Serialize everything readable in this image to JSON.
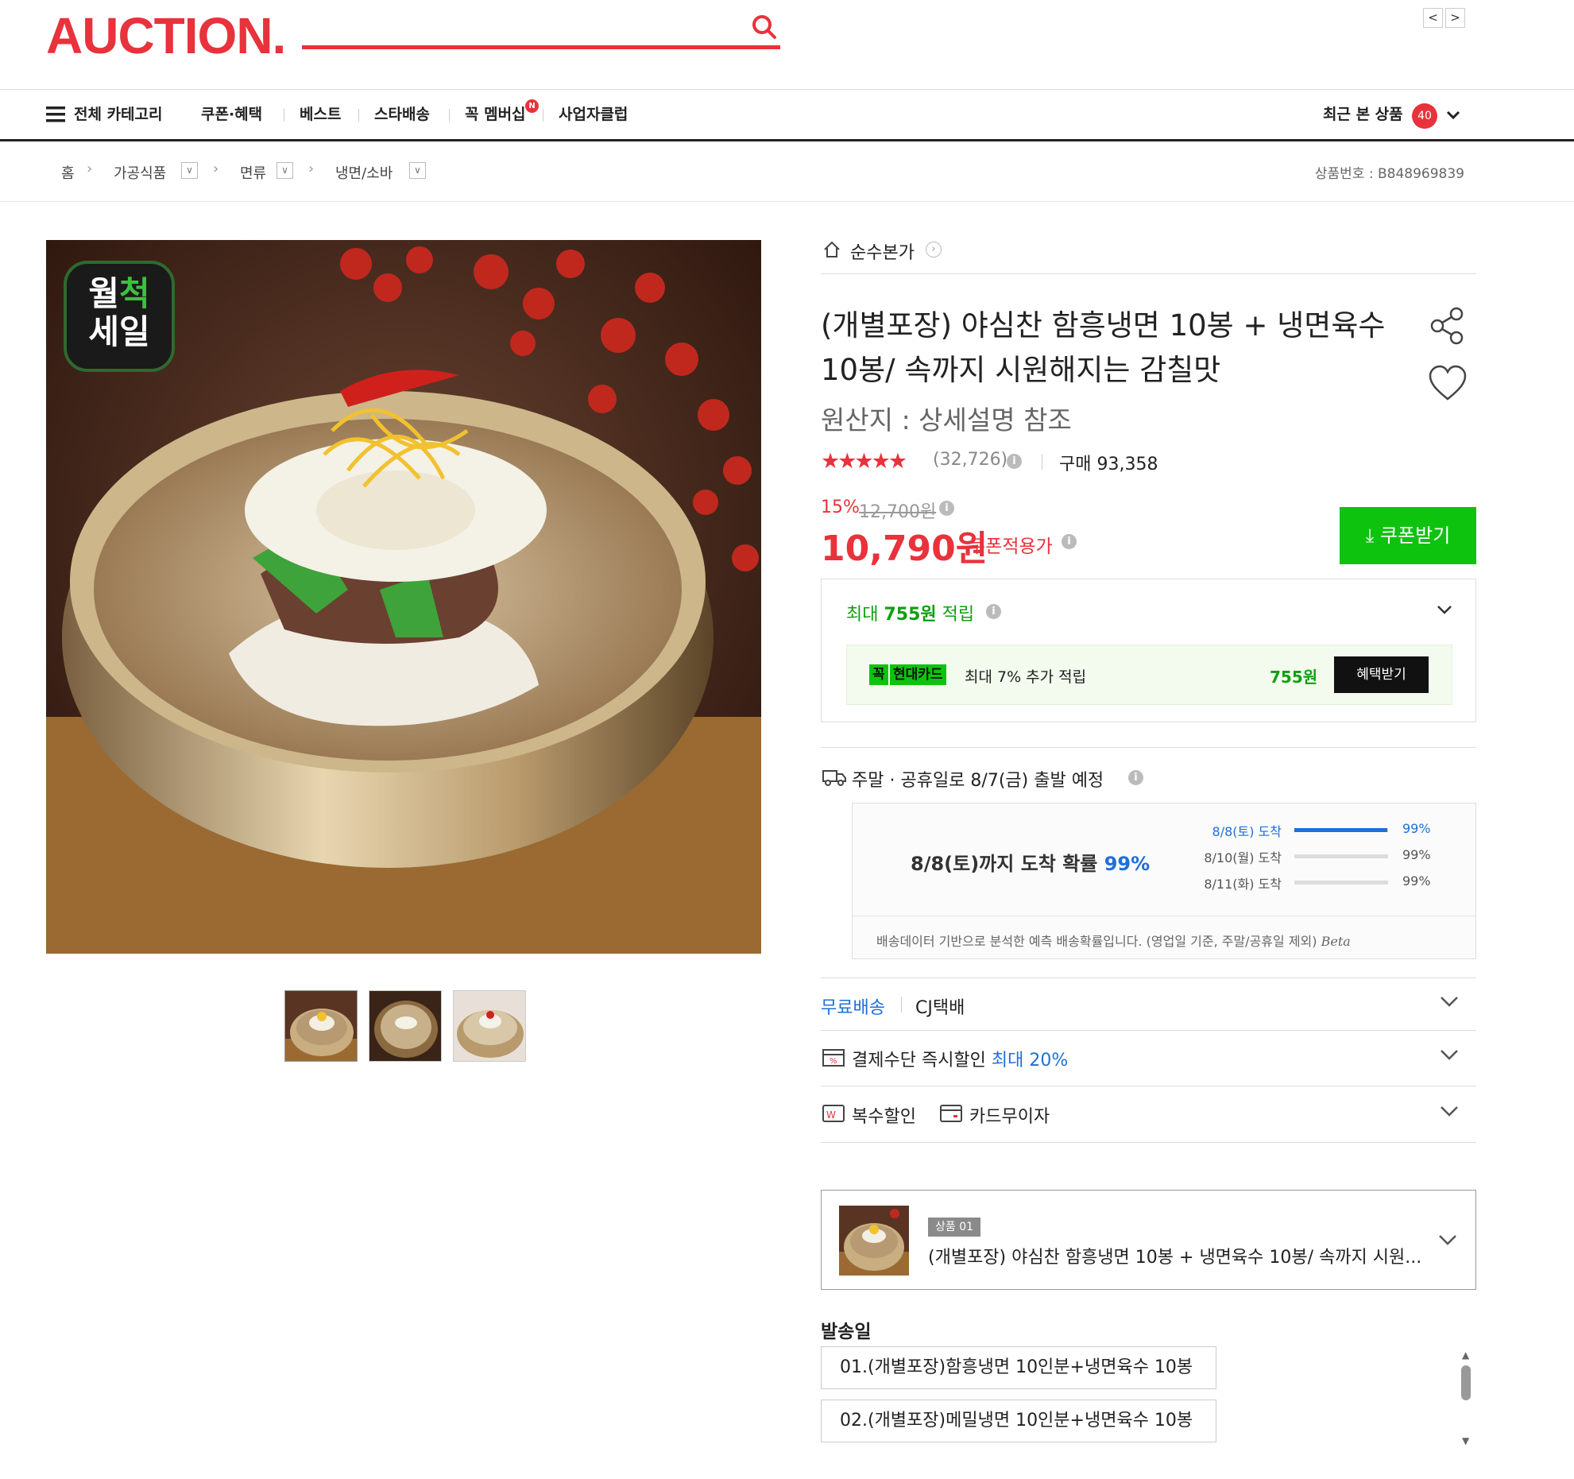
{
  "header": {
    "logo": "AUCTION.",
    "nav_prev": "<",
    "nav_next": ">"
  },
  "topnav": {
    "category_label": "전체 카테고리",
    "items": [
      "쿠폰·혜택",
      "베스트",
      "스타배송",
      "꼭 멤버십",
      "사업자클럽"
    ],
    "membership_badge": "N",
    "recent_label": "최근 본 상품",
    "recent_count": "40"
  },
  "breadcrumb": {
    "items": [
      "홈",
      "가공식품",
      "면류",
      "냉면/소바"
    ],
    "product_no": "상품번호 : B848969839"
  },
  "images": {
    "badge_line1": "월",
    "badge_highlight": "척",
    "badge_line2": "세일",
    "thumbnail_count": 3
  },
  "product": {
    "brand": "순수본가",
    "title": "(개별포장) 야심찬 함흥냉면 10봉 + 냉면육수 10봉/ 속까지 시원해지는 감칠맛",
    "origin": "원산지 : 상세설명 참조",
    "rating": 4.5,
    "stars": "★★★★★",
    "review_count": "(32,726)",
    "purchase_label": "구매 93,358"
  },
  "pricing": {
    "discount_rate": "15%",
    "original_price": "12,700원",
    "price": "10,790원",
    "coupon_price_label": "쿠폰적용가",
    "coupon_button": "쿠폰받기"
  },
  "points": {
    "label_prefix": "최대 ",
    "amount": "755원",
    "label_suffix": " 적립",
    "card_badge": "꼭",
    "card_name": "현대카드",
    "card_desc": "최대 7% 추가 적립",
    "card_amount": "755원",
    "card_button": "혜택받기"
  },
  "shipping": {
    "schedule": "주말 · 공휴일로 8/7(금) 출발 예정",
    "arrival_prefix": "8/8(토)까지 도착 확률 ",
    "arrival_prob": "99%",
    "rows": [
      {
        "label": "8/8(토) 도착",
        "value": "99%",
        "fill": 0.99
      },
      {
        "label": "8/10(월) 도착",
        "value": "99%",
        "fill": 0
      },
      {
        "label": "8/11(화) 도착",
        "value": "99%",
        "fill": 0
      }
    ],
    "note": "배송데이터 기반으로 분석한 예측 배송확률입니다. (영업일 기준, 주말/공휴일 제외)",
    "beta": "Beta",
    "free_label": "무료배송",
    "carrier": "CJ택배"
  },
  "benefits": {
    "payment_label": "결제수단 즉시할인 ",
    "payment_highlight": "최대 20%",
    "multi_label": "복수할인",
    "installment_label": "카드무이자"
  },
  "selected_item": {
    "tag": "상품 01",
    "title": "(개별포장) 야심찬 함흥냉면 10봉 + 냉면육수 10봉/ 속까지 시원..."
  },
  "options": {
    "heading": "발송일",
    "items": [
      "01.(개별포장)함흥냉면 10인분+냉면육수 10봉",
      "02.(개별포장)메밀냉면 10인분+냉면육수 10봉"
    ]
  },
  "colors": {
    "brand_red": "#e8323c",
    "green": "#0ec30e",
    "blue": "#1e6fd9"
  }
}
